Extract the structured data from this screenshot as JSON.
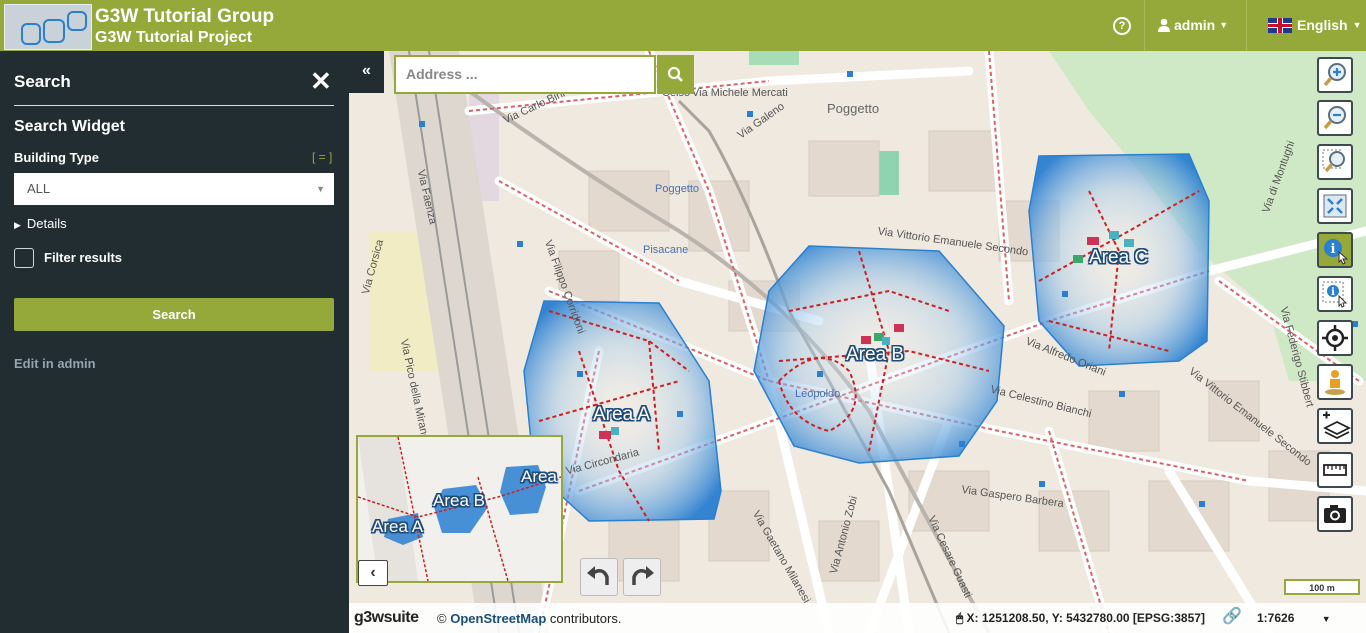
{
  "header": {
    "group_title": "G3W Tutorial Group",
    "project_title": "G3W Tutorial Project",
    "help_icon": "question-circle-icon",
    "user_label": "admin",
    "language_label": "English"
  },
  "sidebar": {
    "panel_title": "Search",
    "widget_title": "Search Widget",
    "field_label": "Building Type",
    "field_bracket": "[ = ]",
    "select_value": "ALL",
    "details_label": "Details",
    "filter_label": "Filter results",
    "search_button": "Search",
    "edit_link": "Edit in admin"
  },
  "map": {
    "address_placeholder": "Address ...",
    "areas": [
      "Area A",
      "Area B",
      "Area C"
    ],
    "overview_areas": [
      "Area A",
      "Area B",
      "Area"
    ],
    "streets": {
      "s1": "Celso",
      "s2": "Via Michele Mercati",
      "s3": "Via Carlo Bini",
      "s4": "Via Galeno",
      "s5": "Poggetto",
      "s6": "Via Vittorio Emanuele Secondo",
      "s7": "Via Filippo Corridoni",
      "s8": "Pisacane",
      "s9": "Via Alfredo Oriani",
      "s10": "Via Celestino Bianchi",
      "s11": "Via Gaspero Barbera",
      "s12": "Via Vittorio Emanuele Secondo",
      "s13": "Via Federigo Stibbert",
      "s14": "Via Gaetano Milanesi",
      "s15": "Via Cesare Guasti",
      "s16": "Via Antonio Zobi",
      "s17": "Poggetto",
      "s18": "Leopoldo",
      "s19": "Via Circondaria",
      "s20": "Via di Montughi",
      "s21": "Via Corsica",
      "s22": "Via Pico della Mirandola",
      "s23": "Via Faenza"
    },
    "footer": {
      "brand": "g3wsuite",
      "copyright": "©",
      "osm_link": "OpenStreetMap",
      "contributors": "contributors.",
      "coords": "X: 1251208.50, Y: 5432780.00",
      "epsg": "[EPSG:3857]",
      "scale": "1:7626"
    },
    "scalebar": "100 m",
    "tools": [
      "zoom-in-icon",
      "zoom-out-icon",
      "zoom-box-icon",
      "zoom-extent-icon",
      "query-info-icon",
      "query-bbox-icon",
      "geolocation-icon",
      "streetview-icon",
      "add-layer-icon",
      "measure-icon",
      "screenshot-icon"
    ]
  },
  "colors": {
    "accent": "#95a83a",
    "sidebar_bg": "#222d32",
    "area_fill": "#2a7fd0"
  }
}
